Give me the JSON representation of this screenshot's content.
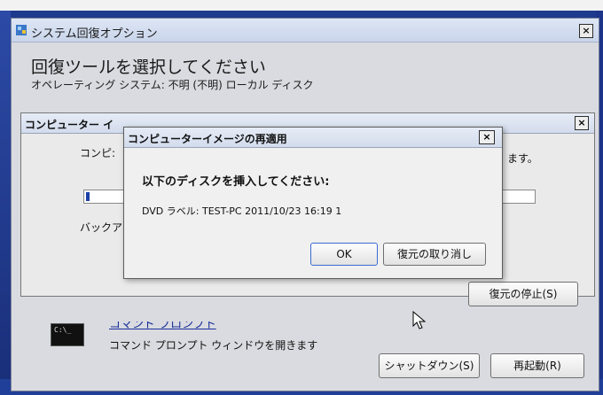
{
  "window": {
    "title": "システム回復オプション",
    "close_glyph": "×",
    "heading": "回復ツールを選択してください",
    "subheading": "オペレーティング システム: 不明 (不明) ローカル ディスク"
  },
  "background_dialog": {
    "title": "コンピューター イ",
    "close_glyph": "×",
    "body_text": "コンピ:",
    "body_tail": "ます。",
    "backup_label": "バックア",
    "stop_restore_label": "復元の停止(S)"
  },
  "front_dialog": {
    "title": "コンピューターイメージの再適用",
    "close_glyph": "×",
    "prompt": "以下のディスクを挿入してください:",
    "disk_label": "DVD ラベル: TEST-PC 2011/10/23 16:19  1",
    "ok_label": "OK",
    "cancel_restore_label": "復元の取り消し"
  },
  "tools": {
    "command_prompt_icon_text": "C:\\_",
    "command_prompt_link": "コマンド プロンプト",
    "command_prompt_desc": "コマンド プロンプト ウィンドウを開きます"
  },
  "footer": {
    "shutdown_label": "シャットダウン(S)",
    "restart_label": "再起動(R)"
  },
  "colors": {
    "desktop": "#1d3a8c",
    "window_bg": "#d9dbe0",
    "link": "#1a2f9a"
  }
}
